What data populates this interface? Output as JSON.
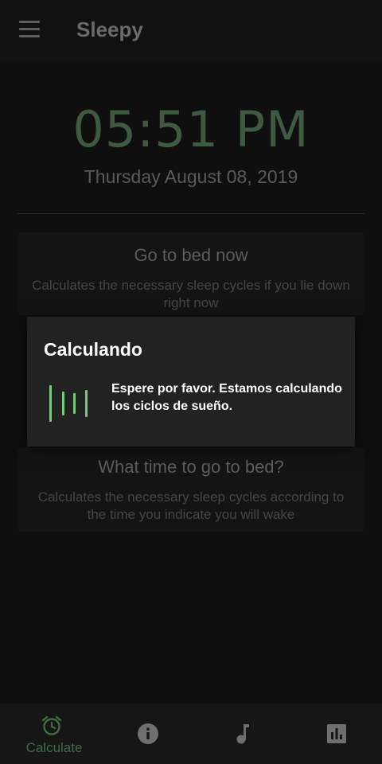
{
  "app": {
    "title": "Sleepy"
  },
  "clock": {
    "time": "05:51 PM",
    "date": "Thursday August 08, 2019"
  },
  "cards": [
    {
      "title": "Go to bed now",
      "description": "Calculates the necessary sleep cycles if you lie down right now"
    },
    {
      "title": "What time to go to bed?",
      "description": "Calculates the necessary sleep cycles according to the time you indicate you will wake"
    }
  ],
  "dialog": {
    "title": "Calculando",
    "message": "Espere por favor. Estamos calculando los ciclos de sueño."
  },
  "bottom_nav": {
    "active": "Calculate",
    "items": [
      {
        "label": "Calculate",
        "icon": "alarm-clock-icon"
      },
      {
        "label": "",
        "icon": "info-icon"
      },
      {
        "label": "",
        "icon": "music-note-icon"
      },
      {
        "label": "",
        "icon": "bar-chart-icon"
      }
    ]
  },
  "colors": {
    "background": "#0f0f0f",
    "accent": "#7ac87d",
    "clock": "#3e5a41",
    "dialog": "#222222"
  }
}
